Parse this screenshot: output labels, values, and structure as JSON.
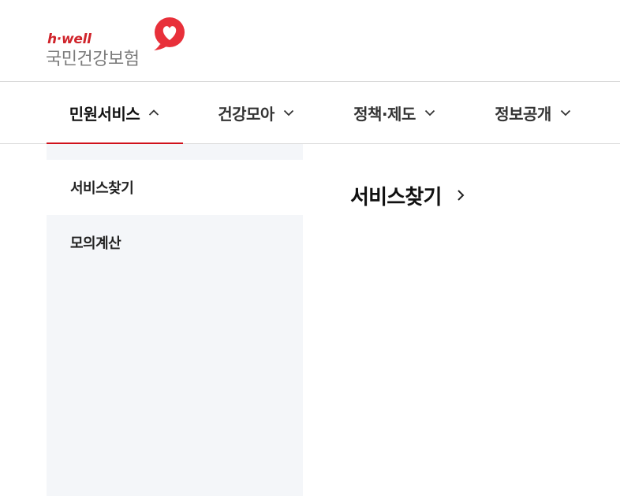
{
  "logo": {
    "sub_text": "h·well",
    "main_text": "국민건강보험",
    "brand_color": "#d0242b",
    "heart_icon": "heart-badge-icon"
  },
  "gnb": {
    "items": [
      {
        "label": "민원서비스",
        "icon": "chevron-up-icon",
        "active": true
      },
      {
        "label": "건강모아",
        "icon": "chevron-down-icon",
        "active": false
      },
      {
        "label": "정책·제도",
        "icon": "chevron-down-icon",
        "active": false
      },
      {
        "label": "정보공개",
        "icon": "chevron-down-icon",
        "active": false
      }
    ],
    "active_indicator_color": "#d0111b"
  },
  "submenu": {
    "items": [
      {
        "label": "서비스찾기",
        "selected": true
      },
      {
        "label": "모의계산",
        "selected": false
      }
    ],
    "background": "#f4f6f9"
  },
  "content": {
    "title": "서비스찾기",
    "title_icon": "chevron-right-icon"
  }
}
